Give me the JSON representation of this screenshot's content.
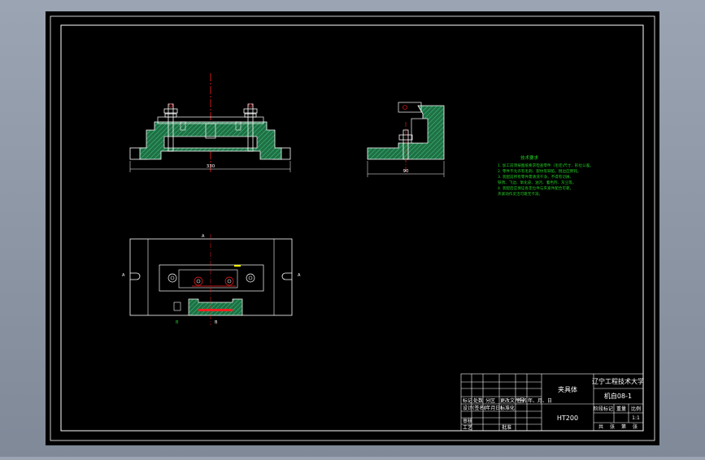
{
  "drawing": {
    "dimensions": {
      "front_width": "330",
      "side_width": "90"
    },
    "section_marks": {
      "top_center": "A",
      "left": "A",
      "right": "A",
      "bottom_left": "B",
      "bottom_right": "B"
    },
    "technical_requirements": {
      "title": "技术要求",
      "lines": [
        "1. 加工前须按图纸要求检查零件（毛坯)尺寸、形位公差。",
        "2. 零件不允许有毛刺、裂纹等缺陷，锐边应倒钝。",
        "3. 装配前所有零件需清洗干净，不得有切屑、",
        "铁锈、飞边、氧化皮、油污、着色剂、灰尘等。",
        "4. 装配后应保证各定位件与夹紧件配合可靠，",
        "夹紧动作灵活可靠无卡滞。"
      ]
    },
    "title_block": {
      "part_name": "夹具体",
      "school": "辽宁工程技术大学",
      "drawing_no": "机自08-1",
      "material": "HT200",
      "scale": "1:1",
      "stage_labels": [
        "阶段标记",
        "重量",
        "比例"
      ],
      "sheet_labels": [
        "共",
        "张",
        "第",
        "张"
      ],
      "left_rows": [
        [
          "标记",
          "处数",
          "分区",
          "更改文件号",
          "签名",
          "年、月、日"
        ],
        [
          "设计",
          "(签名)",
          "(年月日)",
          "标准化",
          "",
          ""
        ],
        [
          "审核",
          "",
          "",
          "",
          "",
          ""
        ],
        [
          "工艺",
          "",
          "",
          "批准",
          "",
          ""
        ]
      ]
    },
    "colors": {
      "background": "#000000",
      "line": "#ffffff",
      "centerline": "#ff2020",
      "hatch": "#2a9d5a",
      "text_green": "#22cc22",
      "bolt": "#ffffff",
      "accent_yellow": "#ffff00"
    }
  }
}
